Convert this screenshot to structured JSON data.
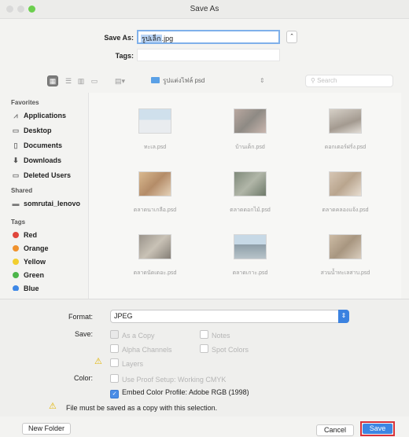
{
  "window": {
    "title": "Save As"
  },
  "save_as": {
    "label": "Save As:",
    "value_selected": "รูปเล็ก",
    "value_rest": ".jpg"
  },
  "tags": {
    "label": "Tags:"
  },
  "toolbar": {
    "location": "รูปแต่งไฟล์ psd",
    "search_placeholder": "Search"
  },
  "sidebar": {
    "favorites_heading": "Favorites",
    "favorites": [
      "Applications",
      "Desktop",
      "Documents",
      "Downloads",
      "Deleted Users"
    ],
    "shared_heading": "Shared",
    "shared": [
      "somrutai_lenovo"
    ],
    "tags_heading": "Tags",
    "tags": [
      {
        "label": "Red",
        "color": "#e0463c"
      },
      {
        "label": "Orange",
        "color": "#f0922e"
      },
      {
        "label": "Yellow",
        "color": "#f2cf2f"
      },
      {
        "label": "Green",
        "color": "#4cb54a"
      },
      {
        "label": "Blue",
        "color": "#3d87e6"
      }
    ]
  },
  "files": [
    "ทะเล.psd",
    "บ้านเด็ก.psd",
    "ดอกเตอร์ฝรั่ง.psd",
    "ตลาดนาเกลือ.psd",
    "ตลาดดอกไม้.psd",
    "ตลาดคลองแจ้ง.psd",
    "ตลาดนัดเดอะ.psd",
    "ตลาดเกาะ.psd",
    "สวนน้ำทะเลสาบ.psd"
  ],
  "options": {
    "format_label": "Format:",
    "format_value": "JPEG",
    "save_label": "Save:",
    "as_a_copy": "As a Copy",
    "notes": "Notes",
    "alpha_channels": "Alpha Channels",
    "spot_colors": "Spot Colors",
    "layers": "Layers",
    "color_label": "Color:",
    "use_proof_setup": "Use Proof Setup:  Working CMYK",
    "embed_profile": "Embed Color Profile:  Adobe RGB (1998)",
    "warning": "File must be saved as a copy with this selection."
  },
  "footer": {
    "new_folder": "New Folder",
    "cancel": "Cancel",
    "save": "Save"
  }
}
